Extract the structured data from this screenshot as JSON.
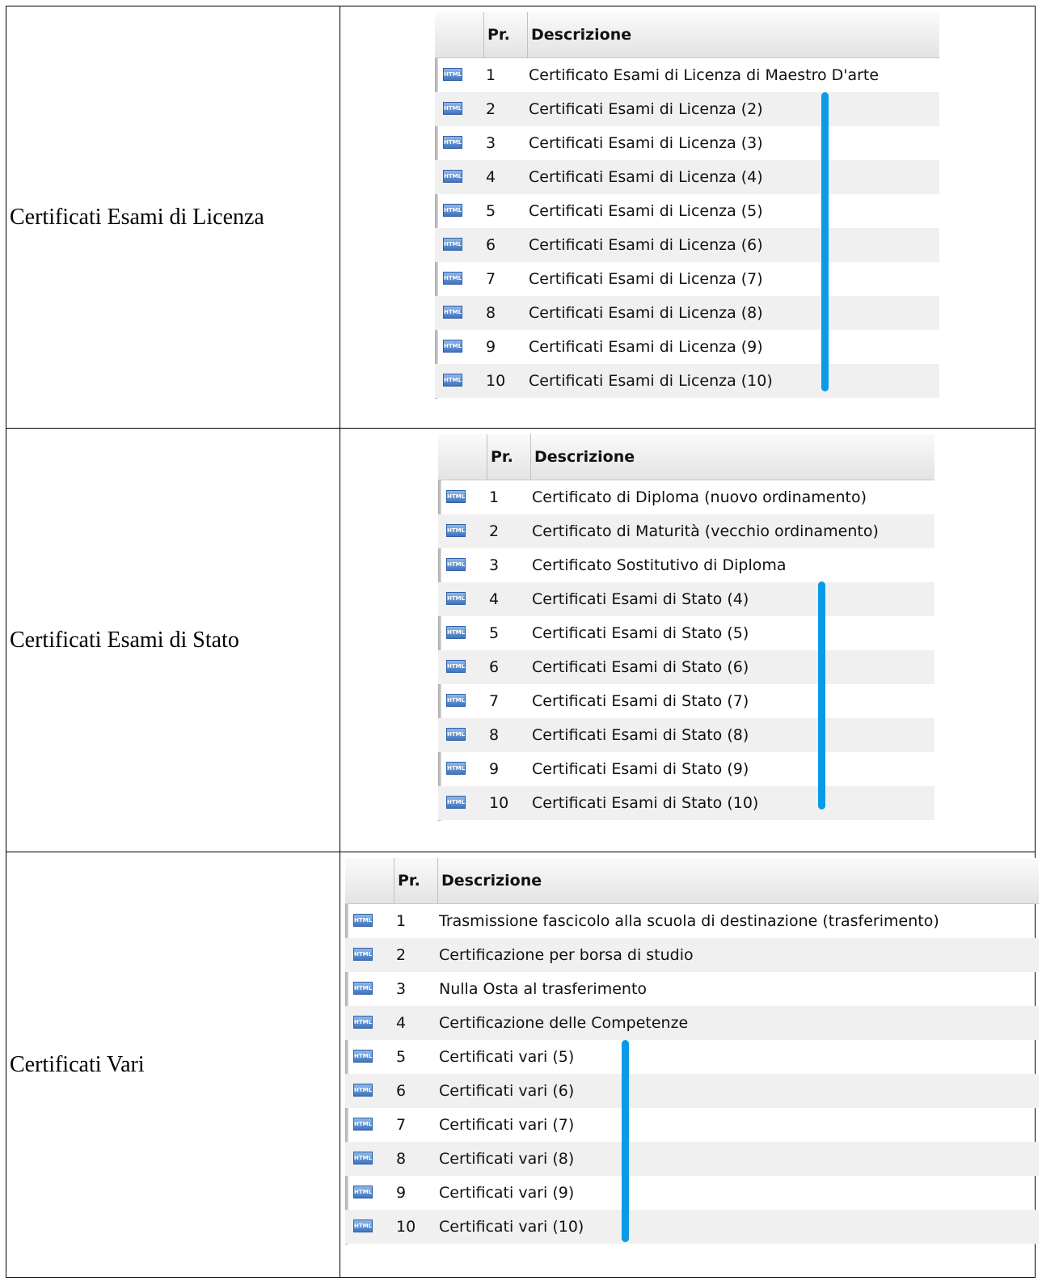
{
  "columns": {
    "pr": "Pr.",
    "descrizione": "Descrizione"
  },
  "icon_text": "HTML",
  "sections": [
    {
      "label": "Certificati Esami di Licenza",
      "rows": [
        {
          "pr": "1",
          "desc": "Certificato Esami di Licenza di Maestro D'arte"
        },
        {
          "pr": "2",
          "desc": "Certificati Esami di Licenza (2)"
        },
        {
          "pr": "3",
          "desc": "Certificati Esami di Licenza (3)"
        },
        {
          "pr": "4",
          "desc": "Certificati Esami di Licenza (4)"
        },
        {
          "pr": "5",
          "desc": "Certificati Esami di Licenza (5)"
        },
        {
          "pr": "6",
          "desc": "Certificati Esami di Licenza (6)"
        },
        {
          "pr": "7",
          "desc": "Certificati Esami di Licenza (7)"
        },
        {
          "pr": "8",
          "desc": "Certificati Esami di Licenza (8)"
        },
        {
          "pr": "9",
          "desc": "Certificati Esami di Licenza (9)"
        },
        {
          "pr": "10",
          "desc": "Certificati Esami di Licenza (10)"
        }
      ]
    },
    {
      "label": "Certificati Esami di Stato",
      "rows": [
        {
          "pr": "1",
          "desc": "Certificato di Diploma (nuovo ordinamento)"
        },
        {
          "pr": "2",
          "desc": "Certificato di Maturità (vecchio ordinamento)"
        },
        {
          "pr": "3",
          "desc": "Certificato Sostitutivo di Diploma"
        },
        {
          "pr": "4",
          "desc": "Certificati Esami di Stato (4)"
        },
        {
          "pr": "5",
          "desc": "Certificati Esami di Stato (5)"
        },
        {
          "pr": "6",
          "desc": "Certificati Esami di Stato (6)"
        },
        {
          "pr": "7",
          "desc": "Certificati Esami di Stato (7)"
        },
        {
          "pr": "8",
          "desc": "Certificati Esami di Stato (8)"
        },
        {
          "pr": "9",
          "desc": "Certificati Esami di Stato (9)"
        },
        {
          "pr": "10",
          "desc": "Certificati Esami di Stato (10)"
        }
      ]
    },
    {
      "label": "Certificati Vari",
      "rows": [
        {
          "pr": "1",
          "desc": "Trasmissione fascicolo alla scuola di destinazione (trasferimento)"
        },
        {
          "pr": "2",
          "desc": "Certificazione per borsa di studio"
        },
        {
          "pr": "3",
          "desc": "Nulla Osta al trasferimento"
        },
        {
          "pr": "4",
          "desc": "Certificazione delle Competenze"
        },
        {
          "pr": "5",
          "desc": "Certificati vari (5)"
        },
        {
          "pr": "6",
          "desc": "Certificati vari (6)"
        },
        {
          "pr": "7",
          "desc": "Certificati vari (7)"
        },
        {
          "pr": "8",
          "desc": "Certificati vari (8)"
        },
        {
          "pr": "9",
          "desc": "Certificati vari (9)"
        },
        {
          "pr": "10",
          "desc": "Certificati vari (10)"
        }
      ]
    }
  ],
  "colors": {
    "highlight_bar": "#0b9be6",
    "icon": "#3f74c0",
    "alt_row": "#f0f0f0"
  }
}
